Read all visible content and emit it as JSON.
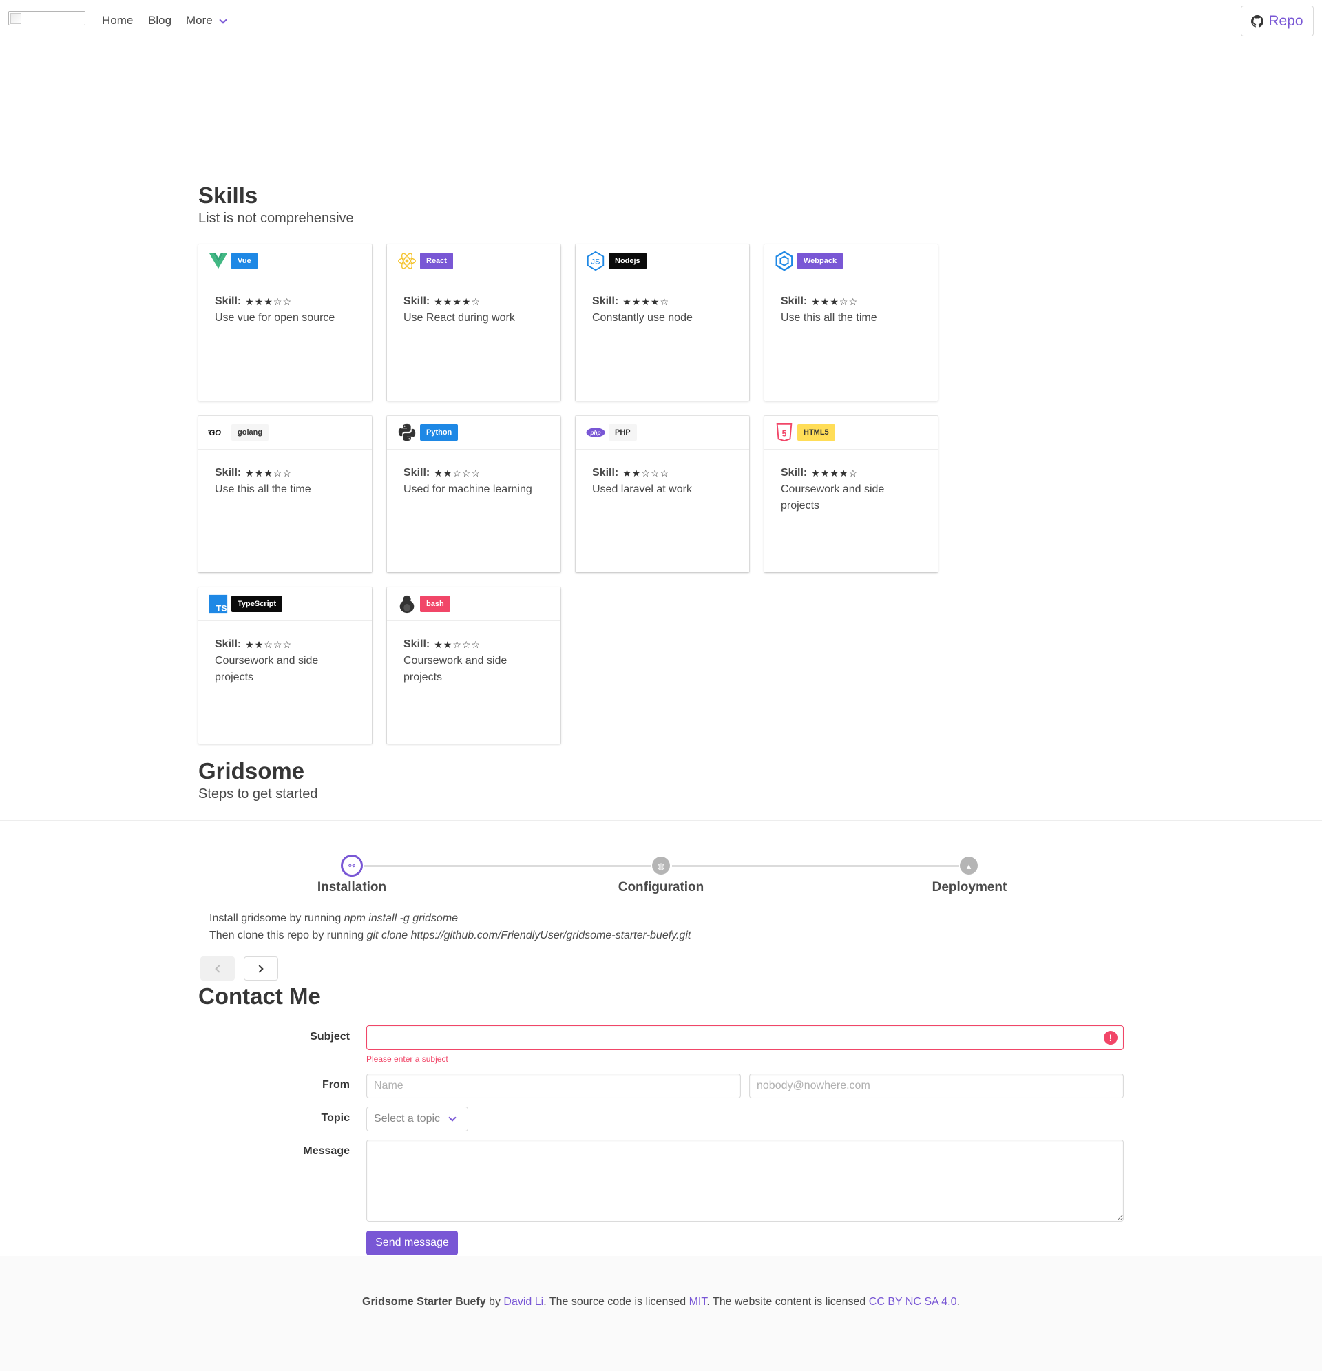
{
  "nav": {
    "home": "Home",
    "blog": "Blog",
    "more": "More",
    "repo": "Repo"
  },
  "skills": {
    "title": "Skills",
    "subtitle": "List is not comprehensive",
    "skill_label": "Skill:",
    "cards": [
      {
        "name": "Vue",
        "tag_color": "#1e88e5",
        "icon": "vue-icon",
        "rating": 3,
        "stars": "★★★☆☆",
        "desc": "Use vue for open source"
      },
      {
        "name": "React",
        "tag_color": "#7957d5",
        "icon": "react-icon",
        "rating": 4,
        "stars": "★★★★☆",
        "desc": "Use React during work"
      },
      {
        "name": "Nodejs",
        "tag_color": "#0a0a0a",
        "icon": "nodejs-icon",
        "rating": 4,
        "stars": "★★★★☆",
        "desc": "Constantly use node"
      },
      {
        "name": "Webpack",
        "tag_color": "#7957d5",
        "icon": "webpack-icon",
        "rating": 3,
        "stars": "★★★☆☆",
        "desc": "Use this all the time"
      },
      {
        "name": "golang",
        "tag_color": "#f5f5f5",
        "icon": "golang-icon",
        "rating": 3,
        "stars": "★★★☆☆",
        "desc": "Use this all the time"
      },
      {
        "name": "Python",
        "tag_color": "#1e88e5",
        "icon": "python-icon",
        "rating": 2,
        "stars": "★★☆☆☆",
        "desc": "Used for machine learning"
      },
      {
        "name": "PHP",
        "tag_color": "#f5f5f5",
        "icon": "php-icon",
        "rating": 2,
        "stars": "★★☆☆☆",
        "desc": "Used laravel at work"
      },
      {
        "name": "HTML5",
        "tag_color": "#ffdd57",
        "icon": "html5-icon",
        "rating": 4,
        "stars": "★★★★☆",
        "desc": "Coursework and side projects"
      },
      {
        "name": "TypeScript",
        "tag_color": "#0a0a0a",
        "icon": "typescript-icon",
        "rating": 2,
        "stars": "★★☆☆☆",
        "desc": "Coursework and side projects"
      },
      {
        "name": "bash",
        "tag_color": "#f14668",
        "icon": "linux-tux-icon",
        "rating": 2,
        "stars": "★★☆☆☆",
        "desc": "Coursework and side projects"
      }
    ]
  },
  "gridsome": {
    "title": "Gridsome",
    "subtitle": "Steps to get started",
    "steps": [
      {
        "label": "Installation",
        "icon": "cog-icon",
        "active": true
      },
      {
        "label": "Configuration",
        "icon": "globe-icon",
        "active": false
      },
      {
        "label": "Deployment",
        "icon": "flag-icon",
        "active": false
      }
    ],
    "content": {
      "line1_text": "Install gridsome by running ",
      "line1_code": "npm install -g gridsome",
      "line2_text": "Then clone this repo by running ",
      "line2_code": "git clone https://github.com/FriendlyUser/gridsome-starter-buefy.git"
    }
  },
  "contact": {
    "title": "Contact Me",
    "subject_label": "Subject",
    "subject_value": "",
    "subject_error": "Please enter a subject",
    "from_label": "From",
    "name_placeholder": "Name",
    "email_placeholder": "nobody@nowhere.com",
    "topic_label": "Topic",
    "topic_placeholder": "Select a topic",
    "message_label": "Message",
    "send_label": "Send message"
  },
  "footer": {
    "project": "Gridsome Starter Buefy",
    "by": " by ",
    "author": "David Li",
    "code_license_text": ". The source code is licensed ",
    "code_license": "MIT",
    "content_license_text": ". The website content is licensed ",
    "content_license": "CC BY NC SA 4.0",
    "end": "."
  },
  "colors": {
    "primary": "#7957d5",
    "danger": "#f14668",
    "text": "#4a4a4a"
  }
}
